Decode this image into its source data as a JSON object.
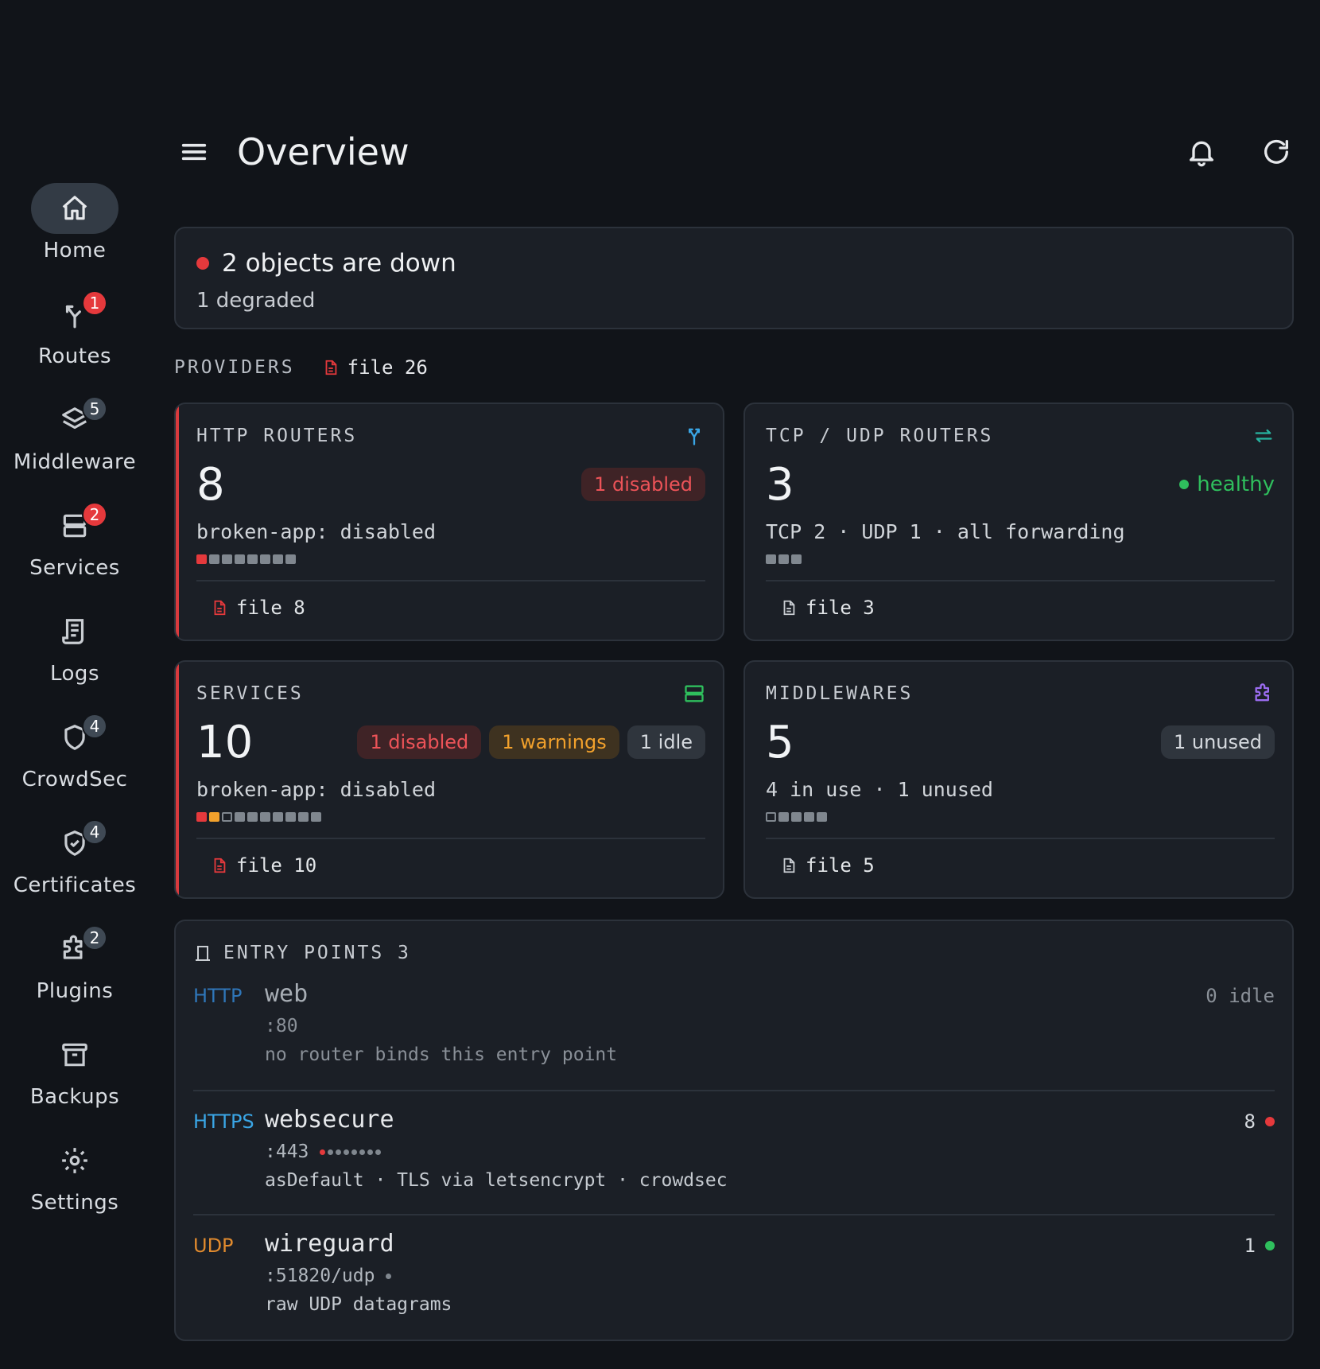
{
  "header": {
    "title": "Overview"
  },
  "sidebar": {
    "items": [
      {
        "label": "Home",
        "icon": "home-icon",
        "badge": "",
        "active": true
      },
      {
        "label": "Routes",
        "icon": "routes-icon",
        "badge": "1",
        "badge_color": "#e5393c"
      },
      {
        "label": "Middleware",
        "icon": "layers-icon",
        "badge": "5",
        "badge_color": "#3f4954"
      },
      {
        "label": "Services",
        "icon": "server-icon",
        "badge": "2",
        "badge_color": "#e5393c"
      },
      {
        "label": "Logs",
        "icon": "logs-icon",
        "badge": ""
      },
      {
        "label": "CrowdSec",
        "icon": "shield-icon",
        "badge": "4",
        "badge_color": "#3f4954"
      },
      {
        "label": "Certificates",
        "icon": "shield-check-icon",
        "badge": "4",
        "badge_color": "#3f4954"
      },
      {
        "label": "Plugins",
        "icon": "puzzle-icon",
        "badge": "2",
        "badge_color": "#3f4954"
      },
      {
        "label": "Backups",
        "icon": "archive-icon",
        "badge": ""
      },
      {
        "label": "Settings",
        "icon": "gear-icon",
        "badge": ""
      }
    ]
  },
  "alert": {
    "title": "2 objects are down",
    "subtitle": "1 degraded"
  },
  "providers": {
    "label": "PROVIDERS",
    "chip_name": "file",
    "chip_count": "26"
  },
  "cards": {
    "http": {
      "title": "HTTP ROUTERS",
      "count": "8",
      "pill_disabled": "1 disabled",
      "desc": "broken-app: disabled",
      "foot_name": "file",
      "foot_count": "8"
    },
    "tcp": {
      "title": "TCP / UDP ROUTERS",
      "count": "3",
      "health": "healthy",
      "desc": "TCP 2 · UDP 1 · all forwarding",
      "foot_name": "file",
      "foot_count": "3"
    },
    "services": {
      "title": "SERVICES",
      "count": "10",
      "pill_disabled": "1 disabled",
      "pill_warnings": "1 warnings",
      "pill_idle": "1 idle",
      "desc": "broken-app: disabled",
      "foot_name": "file",
      "foot_count": "10"
    },
    "middlewares": {
      "title": "MIDDLEWARES",
      "count": "5",
      "pill_unused": "1 unused",
      "desc": "4 in use · 1 unused",
      "foot_name": "file",
      "foot_count": "5"
    }
  },
  "entry_points": {
    "title": "ENTRY POINTS 3",
    "items": [
      {
        "proto": "HTTP",
        "proto_color": "#2f76b8",
        "name": "web",
        "port": ":80",
        "note": "no router binds this entry point",
        "right": "0 idle"
      },
      {
        "proto": "HTTPS",
        "proto_color": "#3aa6e6",
        "name": "websecure",
        "port": ":443",
        "note": "asDefault · TLS via letsencrypt · crowdsec",
        "right": "8",
        "dot_color": "#e5393c"
      },
      {
        "proto": "UDP",
        "proto_color": "#e08a2e",
        "name": "wireguard",
        "port": ":51820/udp",
        "note": "raw UDP datagrams",
        "right": "1",
        "dot_color": "#2fbf5d"
      }
    ]
  },
  "colors": {
    "accent_red": "#e5393c",
    "accent_green": "#2fbf5d",
    "accent_amber": "#f2a12c",
    "accent_purple": "#9b6cf0",
    "accent_blue": "#3aa6e6"
  }
}
